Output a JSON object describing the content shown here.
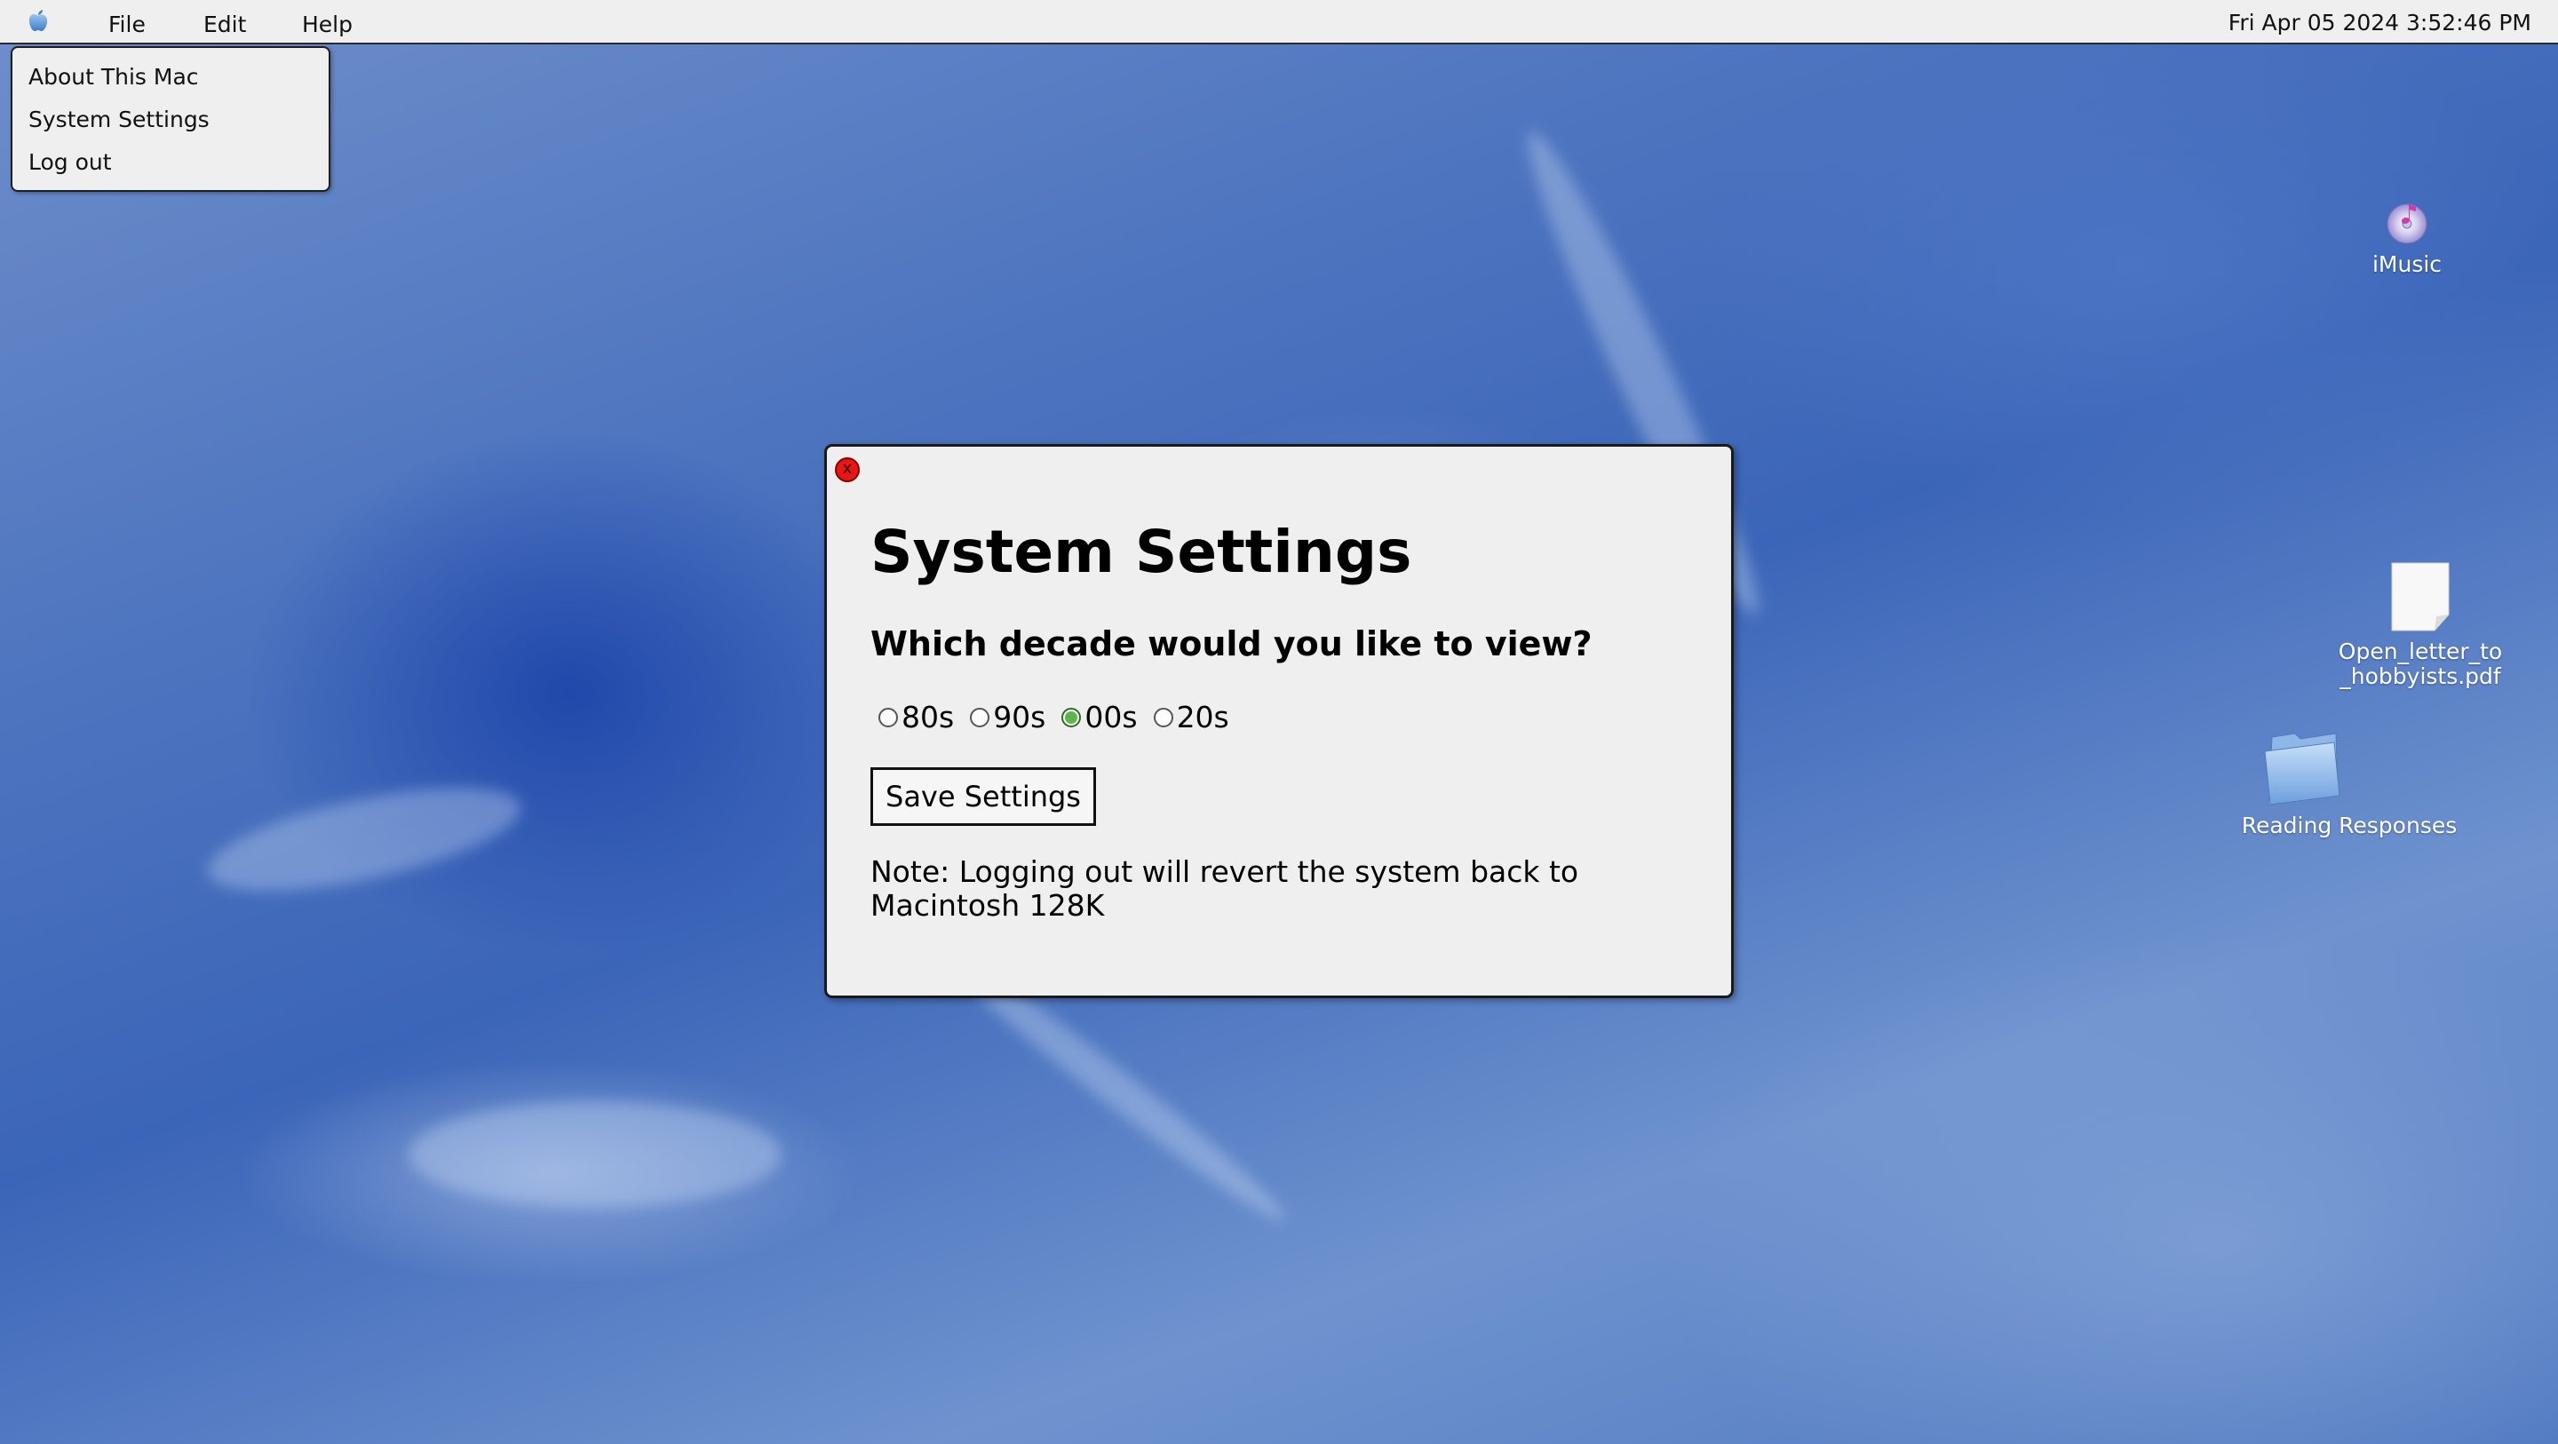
{
  "menubar": {
    "items": [
      "File",
      "Edit",
      "Help"
    ],
    "clock": "Fri Apr 05 2024 3:52:46 PM"
  },
  "apple_menu": {
    "items": [
      "About This Mac",
      "System Settings",
      "Log out"
    ]
  },
  "desktop": {
    "icons": [
      {
        "label": "iMusic",
        "icon": "music-cd-icon"
      },
      {
        "label": "Open_letter_to\n_hobbyists.pdf",
        "line1": "Open_letter_to",
        "line2": "_hobbyists.pdf",
        "icon": "document-icon"
      },
      {
        "label": "Reading Responses",
        "icon": "folder-icon"
      }
    ]
  },
  "dialog": {
    "close_label": "x",
    "title": "System Settings",
    "question": "Which decade would you like to view?",
    "options": [
      "80s",
      "90s",
      "00s",
      "20s"
    ],
    "selected": "00s",
    "save_label": "Save Settings",
    "note": "Note: Logging out will revert the system back to Macintosh 128K"
  },
  "colors": {
    "close_button": "#e51616",
    "radio_selected": "#5eb64a",
    "desktop_blue": "#4d74bf"
  }
}
